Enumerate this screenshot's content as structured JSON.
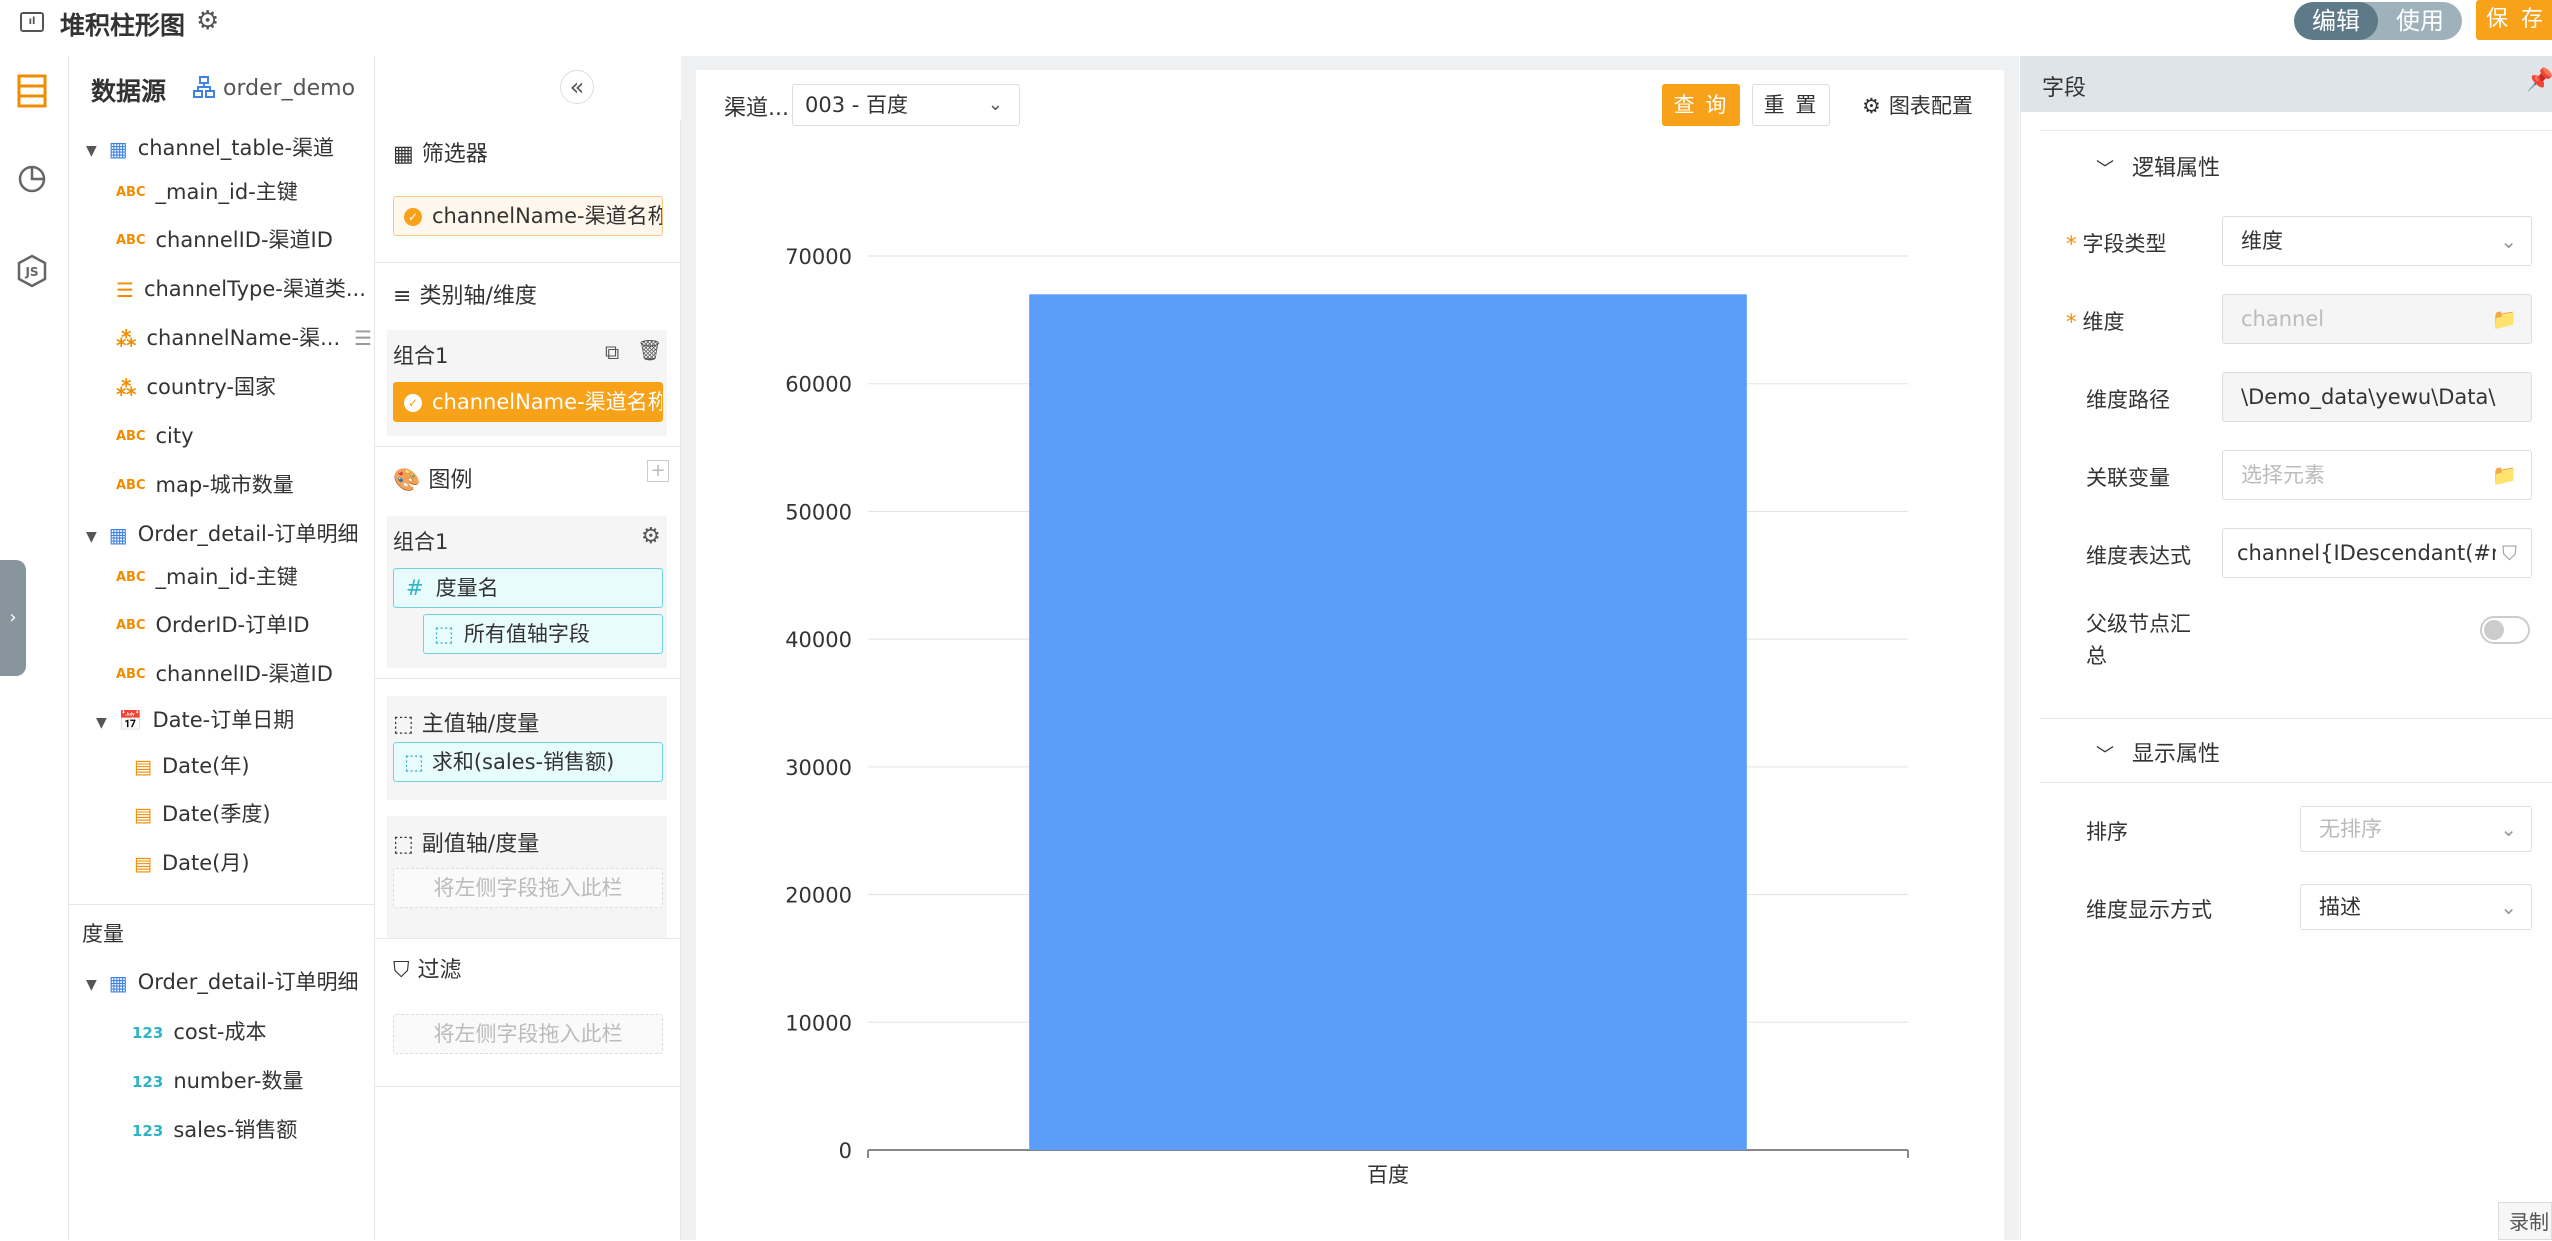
{
  "header": {
    "title": "堆积柱形图",
    "mode_edit": "编辑",
    "mode_use": "使用",
    "save": "保 存",
    "accent": "#f8a21a"
  },
  "datasource": {
    "title": "数据源",
    "db_name": "order_demo",
    "tree": [
      {
        "kind": "table",
        "label": "channel_table-渠道",
        "expanded": true
      },
      {
        "kind": "abc",
        "label": "_main_id-主键"
      },
      {
        "kind": "abc",
        "label": "channelID-渠道ID"
      },
      {
        "kind": "list",
        "label": "channelType-渠道类..."
      },
      {
        "kind": "hier",
        "label": "channelName-渠..."
      },
      {
        "kind": "hier",
        "label": "country-国家"
      },
      {
        "kind": "abc",
        "label": "city"
      },
      {
        "kind": "abc",
        "label": "map-城市数量"
      },
      {
        "kind": "table",
        "label": "Order_detail-订单明细",
        "expanded": true
      },
      {
        "kind": "abc",
        "label": "_main_id-主键"
      },
      {
        "kind": "abc",
        "label": "OrderID-订单ID"
      },
      {
        "kind": "abc",
        "label": "channelID-渠道ID"
      },
      {
        "kind": "cal",
        "label": "Date-订单日期",
        "expanded": true
      },
      {
        "kind": "cal",
        "label": "Date(年)"
      },
      {
        "kind": "cal",
        "label": "Date(季度)"
      },
      {
        "kind": "cal",
        "label": "Date(月)"
      }
    ],
    "measure_title": "度量",
    "measure_table": "Order_detail-订单明细",
    "measures": [
      "cost-成本",
      "number-数量",
      "sales-销售额"
    ]
  },
  "config": {
    "filter_title": "筛选器",
    "filter_item": "channelName-渠道名称",
    "category_title": "类别轴/维度",
    "group_label": "组合1",
    "category_item": "channelName-渠道名称",
    "legend_title": "图例",
    "legend_group_label": "组合1",
    "legend_item1": "度量名",
    "legend_item2": "所有值轴字段",
    "main_axis_title": "主值轴/度量",
    "main_axis_item": "求和(sales-销售额)",
    "sub_axis_title": "副值轴/度量",
    "drop_hint": "将左侧字段拖入此栏",
    "filter2_title": "过滤",
    "drop_hint2": "将左侧字段拖入此栏"
  },
  "toolbar": {
    "filter_label": "渠道...",
    "filter_value": "003 - 百度",
    "query": "查 询",
    "reset": "重 置",
    "chart_config": "图表配置"
  },
  "chart_data": {
    "type": "bar",
    "categories": [
      "百度"
    ],
    "values": [
      67000
    ],
    "ylim": [
      0,
      70000
    ],
    "yticks": [
      0,
      10000,
      20000,
      30000,
      40000,
      50000,
      60000,
      70000
    ],
    "bar_color": "#5a9cf8",
    "grid": true
  },
  "props": {
    "header": "字段",
    "logic_section": "逻辑属性",
    "field_type_label": "字段类型",
    "field_type_value": "维度",
    "dimension_label": "维度",
    "dimension_value": "channel",
    "dim_path_label": "维度路径",
    "dim_path_value": "\\Demo_data\\yewu\\Data\\",
    "assoc_var_label": "关联变量",
    "assoc_var_placeholder": "选择元素",
    "dim_expr_label": "维度表达式",
    "dim_expr_value": "channel{IDescendant(#ro",
    "parent_summary_label": "父级节点汇总",
    "parent_summary_label_1": "父级节点汇",
    "parent_summary_label_2": "总",
    "display_section": "显示属性",
    "sort_label": "排序",
    "sort_value": "无排序",
    "dim_display_label": "维度显示方式",
    "dim_display_value": "描述"
  },
  "record": "录制"
}
